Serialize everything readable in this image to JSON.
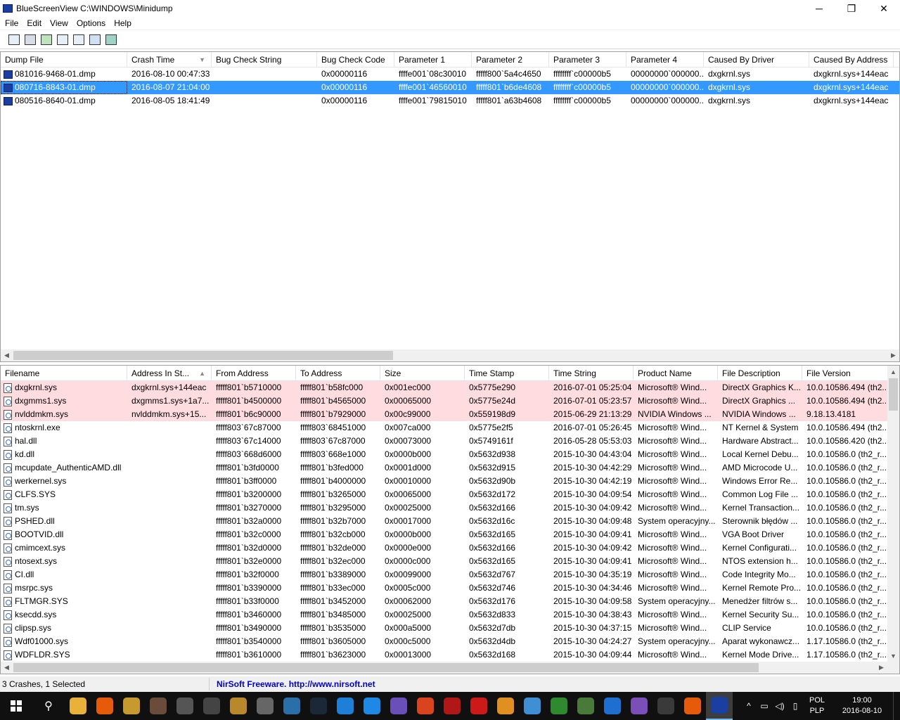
{
  "window": {
    "title": "BlueScreenView   C:\\WINDOWS\\Minidump",
    "minimize": "─",
    "maximize": "❐",
    "close": "✕"
  },
  "menu": [
    "File",
    "Edit",
    "View",
    "Options",
    "Help"
  ],
  "toolbar": [
    "properties-icon",
    "save-icon",
    "refresh-icon",
    "copy-icon",
    "options-icon",
    "search-icon",
    "exit-icon"
  ],
  "top_pane": {
    "columns": [
      "Dump File",
      "Crash Time",
      "Bug Check String",
      "Bug Check Code",
      "Parameter 1",
      "Parameter 2",
      "Parameter 3",
      "Parameter 4",
      "Caused By Driver",
      "Caused By Address"
    ],
    "sort_indicator": "▼",
    "rows": [
      [
        "081016-9468-01.dmp",
        "2016-08-10 00:47:33",
        "",
        "0x00000116",
        "ffffe001`08c30010",
        "fffff800`5a4c4650",
        "ffffffff`c00000b5",
        "00000000`000000...",
        "dxgkrnl.sys",
        "dxgkrnl.sys+144eac"
      ],
      [
        "080716-8843-01.dmp",
        "2016-08-07 21:04:00",
        "",
        "0x00000116",
        "ffffe001`46560010",
        "fffff801`b6de4608",
        "ffffffff`c00000b5",
        "00000000`000000...",
        "dxgkrnl.sys",
        "dxgkrnl.sys+144eac"
      ],
      [
        "080516-8640-01.dmp",
        "2016-08-05 18:41:49",
        "",
        "0x00000116",
        "ffffe001`79815010",
        "fffff801`a63b4608",
        "ffffffff`c00000b5",
        "00000000`000000...",
        "dxgkrnl.sys",
        "dxgkrnl.sys+144eac"
      ]
    ],
    "selected_index": 1
  },
  "bottom_pane": {
    "columns": [
      "Filename",
      "Address In St...",
      "From Address",
      "To Address",
      "Size",
      "Time Stamp",
      "Time String",
      "Product Name",
      "File Description",
      "File Version"
    ],
    "sort_indicator": "▲",
    "highlight_color": "#ffdce0",
    "rows": [
      [
        "dxgkrnl.sys",
        "dxgkrnl.sys+144eac",
        "fffff801`b5710000",
        "fffff801`b58fc000",
        "0x001ec000",
        "0x5775e290",
        "2016-07-01 05:25:04",
        "Microsoft® Wind...",
        "DirectX Graphics K...",
        "10.0.10586.494 (th2..."
      ],
      [
        "dxgmms1.sys",
        "dxgmms1.sys+1a7...",
        "fffff801`b4500000",
        "fffff801`b4565000",
        "0x00065000",
        "0x5775e24d",
        "2016-07-01 05:23:57",
        "Microsoft® Wind...",
        "DirectX Graphics ...",
        "10.0.10586.494 (th2..."
      ],
      [
        "nvlddmkm.sys",
        "nvlddmkm.sys+15...",
        "fffff801`b6c90000",
        "fffff801`b7929000",
        "0x00c99000",
        "0x559198d9",
        "2015-06-29 21:13:29",
        "NVIDIA Windows ...",
        "NVIDIA Windows ...",
        "9.18.13.4181"
      ],
      [
        "ntoskrnl.exe",
        "",
        "fffff803`67c87000",
        "fffff803`68451000",
        "0x007ca000",
        "0x5775e2f5",
        "2016-07-01 05:26:45",
        "Microsoft® Wind...",
        "NT Kernel & System",
        "10.0.10586.494 (th2..."
      ],
      [
        "hal.dll",
        "",
        "fffff803`67c14000",
        "fffff803`67c87000",
        "0x00073000",
        "0x5749161f",
        "2016-05-28 05:53:03",
        "Microsoft® Wind...",
        "Hardware Abstract...",
        "10.0.10586.420 (th2..."
      ],
      [
        "kd.dll",
        "",
        "fffff803`668d6000",
        "fffff803`668e1000",
        "0x0000b000",
        "0x5632d938",
        "2015-10-30 04:43:04",
        "Microsoft® Wind...",
        "Local Kernel Debu...",
        "10.0.10586.0 (th2_r..."
      ],
      [
        "mcupdate_AuthenticAMD.dll",
        "",
        "fffff801`b3fd0000",
        "fffff801`b3fed000",
        "0x0001d000",
        "0x5632d915",
        "2015-10-30 04:42:29",
        "Microsoft® Wind...",
        "AMD Microcode U...",
        "10.0.10586.0 (th2_r..."
      ],
      [
        "werkernel.sys",
        "",
        "fffff801`b3ff0000",
        "fffff801`b4000000",
        "0x00010000",
        "0x5632d90b",
        "2015-10-30 04:42:19",
        "Microsoft® Wind...",
        "Windows Error Re...",
        "10.0.10586.0 (th2_r..."
      ],
      [
        "CLFS.SYS",
        "",
        "fffff801`b3200000",
        "fffff801`b3265000",
        "0x00065000",
        "0x5632d172",
        "2015-10-30 04:09:54",
        "Microsoft® Wind...",
        "Common Log File ...",
        "10.0.10586.0 (th2_r..."
      ],
      [
        "tm.sys",
        "",
        "fffff801`b3270000",
        "fffff801`b3295000",
        "0x00025000",
        "0x5632d166",
        "2015-10-30 04:09:42",
        "Microsoft® Wind...",
        "Kernel Transaction...",
        "10.0.10586.0 (th2_r..."
      ],
      [
        "PSHED.dll",
        "",
        "fffff801`b32a0000",
        "fffff801`b32b7000",
        "0x00017000",
        "0x5632d16c",
        "2015-10-30 04:09:48",
        "System operacyjny...",
        "Sterownik błędów ...",
        "10.0.10586.0 (th2_r..."
      ],
      [
        "BOOTVID.dll",
        "",
        "fffff801`b32c0000",
        "fffff801`b32cb000",
        "0x0000b000",
        "0x5632d165",
        "2015-10-30 04:09:41",
        "Microsoft® Wind...",
        "VGA Boot Driver",
        "10.0.10586.0 (th2_r..."
      ],
      [
        "cmimcext.sys",
        "",
        "fffff801`b32d0000",
        "fffff801`b32de000",
        "0x0000e000",
        "0x5632d166",
        "2015-10-30 04:09:42",
        "Microsoft® Wind...",
        "Kernel Configurati...",
        "10.0.10586.0 (th2_r..."
      ],
      [
        "ntosext.sys",
        "",
        "fffff801`b32e0000",
        "fffff801`b32ec000",
        "0x0000c000",
        "0x5632d165",
        "2015-10-30 04:09:41",
        "Microsoft® Wind...",
        "NTOS extension h...",
        "10.0.10586.0 (th2_r..."
      ],
      [
        "CI.dll",
        "",
        "fffff801`b32f0000",
        "fffff801`b3389000",
        "0x00099000",
        "0x5632d767",
        "2015-10-30 04:35:19",
        "Microsoft® Wind...",
        "Code Integrity Mo...",
        "10.0.10586.0 (th2_r..."
      ],
      [
        "msrpc.sys",
        "",
        "fffff801`b3390000",
        "fffff801`b33ec000",
        "0x0005c000",
        "0x5632d746",
        "2015-10-30 04:34:46",
        "Microsoft® Wind...",
        "Kernel Remote Pro...",
        "10.0.10586.0 (th2_r..."
      ],
      [
        "FLTMGR.SYS",
        "",
        "fffff801`b33f0000",
        "fffff801`b3452000",
        "0x00062000",
        "0x5632d176",
        "2015-10-30 04:09:58",
        "System operacyjny...",
        "Menedżer filtrów s...",
        "10.0.10586.0 (th2_r..."
      ],
      [
        "ksecdd.sys",
        "",
        "fffff801`b3460000",
        "fffff801`b3485000",
        "0x00025000",
        "0x5632d833",
        "2015-10-30 04:38:43",
        "Microsoft® Wind...",
        "Kernel Security Su...",
        "10.0.10586.0 (th2_r..."
      ],
      [
        "clipsp.sys",
        "",
        "fffff801`b3490000",
        "fffff801`b3535000",
        "0x000a5000",
        "0x5632d7db",
        "2015-10-30 04:37:15",
        "Microsoft® Wind...",
        "CLIP Service",
        "10.0.10586.0 (th2_r..."
      ],
      [
        "Wdf01000.sys",
        "",
        "fffff801`b3540000",
        "fffff801`b3605000",
        "0x000c5000",
        "0x5632d4db",
        "2015-10-30 04:24:27",
        "System operacyjny...",
        "Aparat wykonawcz...",
        "1.17.10586.0 (th2_r..."
      ],
      [
        "WDFLDR.SYS",
        "",
        "fffff801`b3610000",
        "fffff801`b3623000",
        "0x00013000",
        "0x5632d168",
        "2015-10-30 04:09:44",
        "Microsoft® Wind...",
        "Kernel Mode Drive...",
        "1.17.10586.0 (th2_r..."
      ]
    ],
    "highlighted_count": 3
  },
  "status": {
    "left": "3 Crashes, 1 Selected",
    "right": "NirSoft Freeware.  http://www.nirsoft.net"
  },
  "taskbar": {
    "apps": [
      {
        "name": "file-explorer-icon",
        "color": "#e8b13a"
      },
      {
        "name": "firefox-icon",
        "color": "#e55b0a"
      },
      {
        "name": "game-icon",
        "color": "#c79a2e"
      },
      {
        "name": "game2-icon",
        "color": "#6b4c3b"
      },
      {
        "name": "star-icon",
        "color": "#555555"
      },
      {
        "name": "bird-icon",
        "color": "#444444"
      },
      {
        "name": "logo-icon",
        "color": "#b9882a"
      },
      {
        "name": "circle-icon",
        "color": "#666666"
      },
      {
        "name": "app-icon",
        "color": "#2b6fa8"
      },
      {
        "name": "steam-icon",
        "color": "#1b2838"
      },
      {
        "name": "play-icon",
        "color": "#1e7fd6"
      },
      {
        "name": "c-icon",
        "color": "#1e88e5"
      },
      {
        "name": "chip-icon",
        "color": "#6a4fb8"
      },
      {
        "name": "paint-icon",
        "color": "#d9441f"
      },
      {
        "name": "racing-icon",
        "color": "#b01818"
      },
      {
        "name": "bolt-icon",
        "color": "#cc1a1a"
      },
      {
        "name": "eye-icon",
        "color": "#e09020"
      },
      {
        "name": "wave-icon",
        "color": "#3f8fd2"
      },
      {
        "name": "xbox-icon",
        "color": "#2f8a2f"
      },
      {
        "name": "monitor-icon",
        "color": "#4a7a3a"
      },
      {
        "name": "lightning-icon",
        "color": "#1f6fd0"
      },
      {
        "name": "swirl-icon",
        "color": "#7a4fb8"
      },
      {
        "name": "alien-icon",
        "color": "#3a3a3a"
      },
      {
        "name": "firefox2-icon",
        "color": "#e55b0a"
      },
      {
        "name": "bluescreenview-icon",
        "color": "#1a3fa0"
      }
    ],
    "tray": {
      "chevron": "^",
      "lang_top": "POL",
      "lang_bottom": "PLP",
      "time": "19:00",
      "date": "2016-08-10"
    }
  }
}
